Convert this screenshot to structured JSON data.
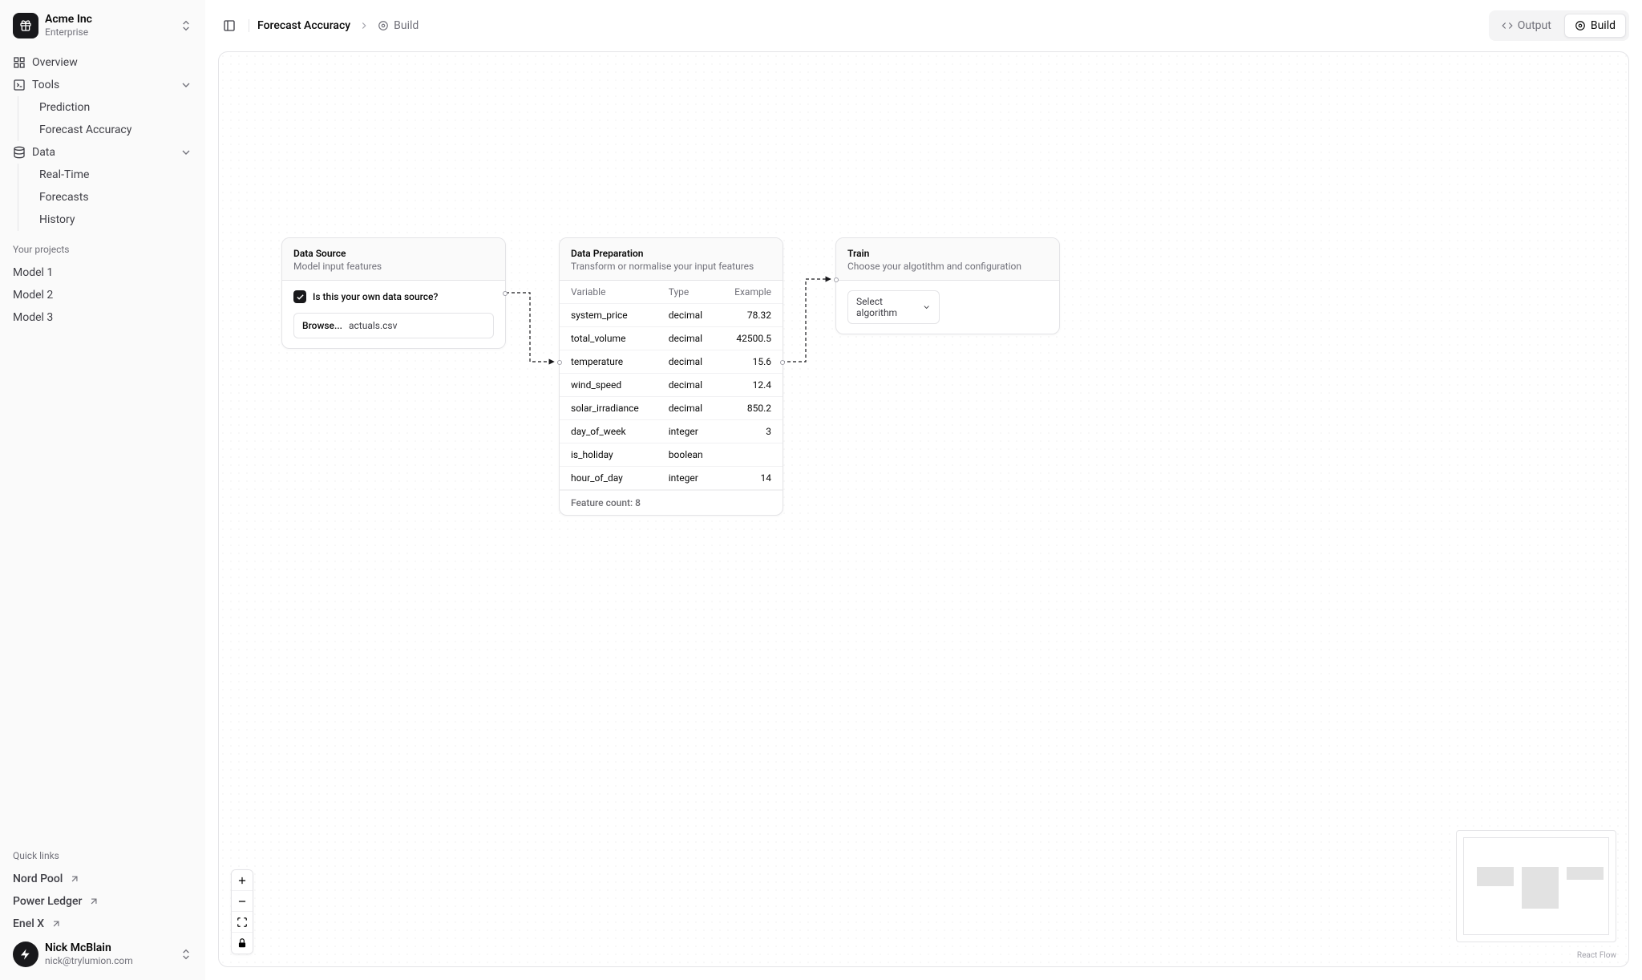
{
  "org": {
    "name": "Acme Inc",
    "tier": "Enterprise"
  },
  "nav": {
    "overview": "Overview",
    "tools": "Tools",
    "tools_items": [
      "Prediction",
      "Forecast Accuracy"
    ],
    "data": "Data",
    "data_items": [
      "Real-Time",
      "Forecasts",
      "History"
    ]
  },
  "projects_label": "Your projects",
  "projects": [
    "Model 1",
    "Model 2",
    "Model 3"
  ],
  "quick_links_label": "Quick links",
  "quick_links": [
    "Nord Pool",
    "Power Ledger",
    "Enel X"
  ],
  "user": {
    "name": "Nick McBlain",
    "email": "nick@trylumion.com"
  },
  "breadcrumb": {
    "root": "Forecast Accuracy",
    "current": "Build"
  },
  "tabs": {
    "output": "Output",
    "build": "Build"
  },
  "nodes": {
    "source": {
      "title": "Data Source",
      "subtitle": "Model input features",
      "checkbox_label": "Is this your own data source?",
      "browse_label": "Browse...",
      "file": "actuals.csv"
    },
    "prep": {
      "title": "Data Preparation",
      "subtitle": "Transform or normalise your input features",
      "headers": [
        "Variable",
        "Type",
        "Example"
      ],
      "rows": [
        {
          "v": "system_price",
          "t": "decimal",
          "e": "78.32"
        },
        {
          "v": "total_volume",
          "t": "decimal",
          "e": "42500.5"
        },
        {
          "v": "temperature",
          "t": "decimal",
          "e": "15.6"
        },
        {
          "v": "wind_speed",
          "t": "decimal",
          "e": "12.4"
        },
        {
          "v": "solar_irradiance",
          "t": "decimal",
          "e": "850.2"
        },
        {
          "v": "day_of_week",
          "t": "integer",
          "e": "3"
        },
        {
          "v": "is_holiday",
          "t": "boolean",
          "e": ""
        },
        {
          "v": "hour_of_day",
          "t": "integer",
          "e": "14"
        }
      ],
      "footer": "Feature count: 8"
    },
    "train": {
      "title": "Train",
      "subtitle": "Choose your algotithm and configuration",
      "select_placeholder": "Select algorithm"
    }
  },
  "attribution": "React Flow"
}
